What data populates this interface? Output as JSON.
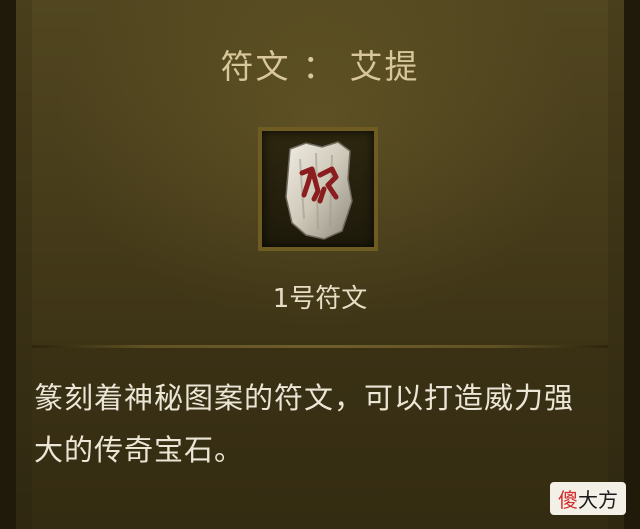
{
  "tooltip": {
    "title_prefix": "符文",
    "title_separator": "：",
    "title_name": "艾提",
    "item_name": "1号符文",
    "description": "篆刻着神秘图案的符文，可以打造威力强大的传奇宝石。"
  },
  "icon": {
    "name": "rune-stone-icon",
    "glyph_color": "#8a1d1d",
    "stone_color": "#d9d4c7"
  },
  "watermark": {
    "accent_char": "傻",
    "rest_text": "大方"
  },
  "colors": {
    "title": "#d8c79a",
    "panel_bg": "#463c1a",
    "frame_border": "#6e5c22",
    "text": "#ece6d6"
  }
}
